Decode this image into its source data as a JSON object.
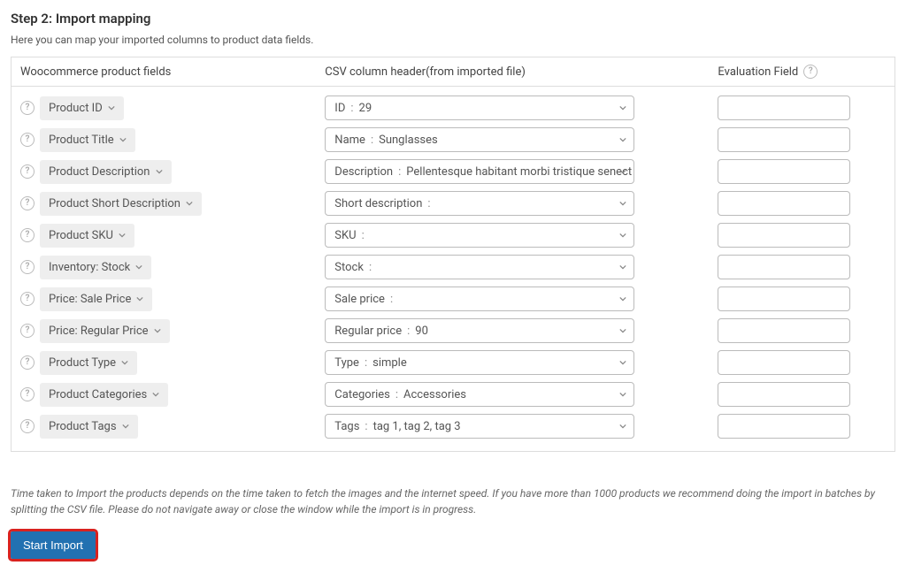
{
  "step_title": "Step 2: Import mapping",
  "step_description": "Here you can map your imported columns to product data fields.",
  "headers": {
    "fields": "Woocommerce product fields",
    "csv": "CSV column header(from imported file)",
    "eval": "Evaluation Field"
  },
  "rows": [
    {
      "field": "Product ID",
      "csv_label": "ID",
      "csv_value": "29"
    },
    {
      "field": "Product Title",
      "csv_label": "Name",
      "csv_value": "Sunglasses"
    },
    {
      "field": "Product Description",
      "csv_label": "Description",
      "csv_value": "Pellentesque habitant morbi tristique senect"
    },
    {
      "field": "Product Short Description",
      "csv_label": "Short description",
      "csv_value": ""
    },
    {
      "field": "Product SKU",
      "csv_label": "SKU",
      "csv_value": ""
    },
    {
      "field": "Inventory: Stock",
      "csv_label": "Stock",
      "csv_value": ""
    },
    {
      "field": "Price: Sale Price",
      "csv_label": "Sale price",
      "csv_value": ""
    },
    {
      "field": "Price: Regular Price",
      "csv_label": "Regular price",
      "csv_value": "90"
    },
    {
      "field": "Product Type",
      "csv_label": "Type",
      "csv_value": "simple"
    },
    {
      "field": "Product Categories",
      "csv_label": "Categories",
      "csv_value": "Accessories"
    },
    {
      "field": "Product Tags",
      "csv_label": "Tags",
      "csv_value": "tag 1, tag 2, tag 3"
    }
  ],
  "disclaimer": "Time taken to Import the products depends on the time taken to fetch the images and the internet speed. If you have more than 1000 products we recommend doing the import in batches by splitting the CSV file. Please do not navigate away or close the window while the import is in progress.",
  "start_button": "Start Import"
}
